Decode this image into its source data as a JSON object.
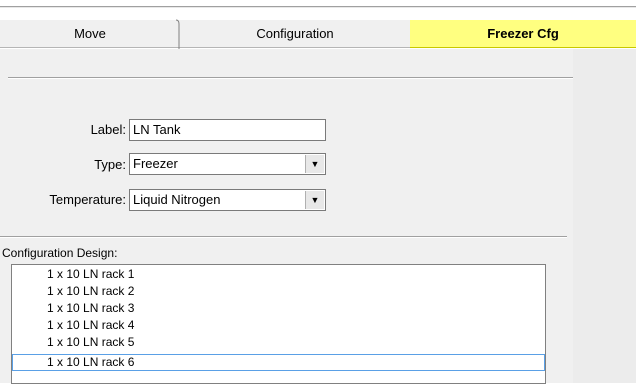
{
  "tabs": [
    {
      "label": "Move"
    },
    {
      "label": "Configuration"
    },
    {
      "label": "Freezer Cfg"
    }
  ],
  "form": {
    "label_caption": "Label:",
    "label_value": "LN Tank",
    "type_caption": "Type:",
    "type_value": "Freezer",
    "temperature_caption": "Temperature:",
    "temperature_value": "Liquid Nitrogen"
  },
  "design": {
    "caption": "Configuration Design:",
    "items": [
      "1 x 10 LN rack 1",
      "1 x 10 LN rack 2",
      "1 x 10 LN rack 3",
      "1 x 10 LN rack 4",
      "1 x 10 LN rack 5",
      "1 x 10 LN rack 6"
    ],
    "selected_index": 5
  },
  "colors": {
    "active_tab": "#ffff80",
    "panel": "#f0f0f0",
    "selection_outline": "#5aa0e6"
  },
  "icons": {
    "dropdown": "chevron-down-icon"
  }
}
